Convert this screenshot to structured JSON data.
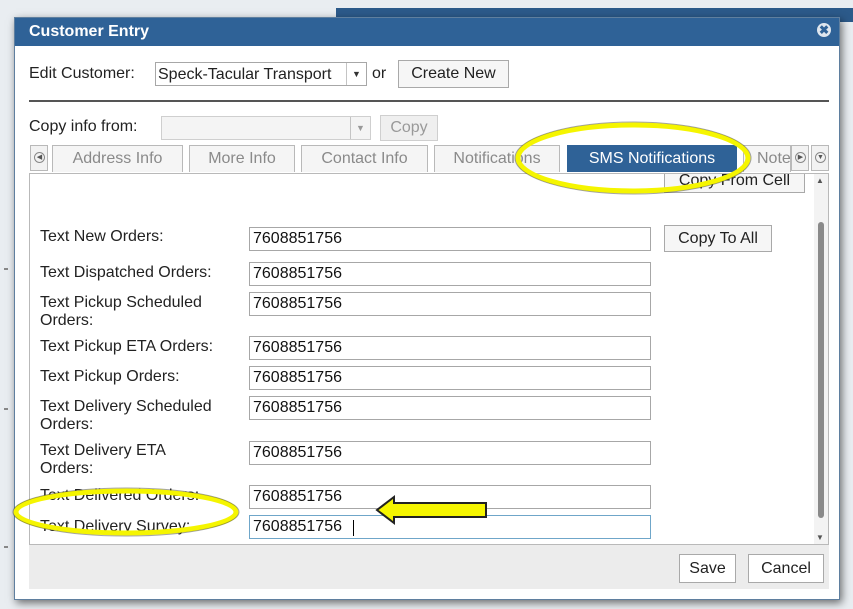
{
  "dialog": {
    "title": "Customer Entry",
    "close_icon": "close-icon"
  },
  "edit_customer": {
    "label": "Edit Customer:",
    "selected": "Speck-Tacular Transport",
    "or_text": "or",
    "create_new_label": "Create New"
  },
  "copy_info": {
    "label": "Copy info from:",
    "selected": "",
    "copy_label": "Copy"
  },
  "tabs": [
    {
      "label": "Address Info",
      "active": false
    },
    {
      "label": "More Info",
      "active": false
    },
    {
      "label": "Contact Info",
      "active": false
    },
    {
      "label": "Notifications",
      "active": false
    },
    {
      "label": "SMS Notifications",
      "active": true
    },
    {
      "label": "Note",
      "active": false
    }
  ],
  "panel": {
    "copy_from_cell_label": "Copy From Cell",
    "copy_to_all_label": "Copy To All",
    "fields": [
      {
        "label": "Text New Orders:",
        "value": "7608851756"
      },
      {
        "label": "Text Dispatched Orders:",
        "value": "7608851756"
      },
      {
        "label": "Text Pickup Scheduled Orders:",
        "value": "7608851756"
      },
      {
        "label": "Text Pickup ETA Orders:",
        "value": "7608851756"
      },
      {
        "label": "Text Pickup Orders:",
        "value": "7608851756"
      },
      {
        "label": "Text Delivery Scheduled Orders:",
        "value": "7608851756"
      },
      {
        "label": "Text Delivery ETA Orders:",
        "value": "7608851756"
      },
      {
        "label": "Text Delivered Orders:",
        "value": "7608851756"
      },
      {
        "label": "Text Delivery Survey:",
        "value": "7608851756"
      }
    ]
  },
  "footer": {
    "save_label": "Save",
    "cancel_label": "Cancel"
  },
  "colors": {
    "title_bar": "#2f6297",
    "active_tab": "#2f6297",
    "highlight": "#f5f500",
    "arrow_fill": "#f5f500"
  }
}
